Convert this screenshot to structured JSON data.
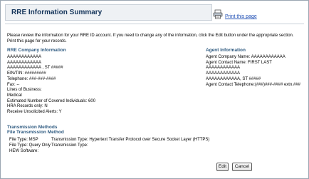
{
  "header": {
    "title": "RRE Information Summary"
  },
  "print": {
    "label": "Print this page"
  },
  "intro": {
    "line1": "Please review the information for your RRE ID account. If you need to change any of the information, click the Edit button under the appropriate section.",
    "line2": "Print this page for your records."
  },
  "rre_company": {
    "heading": "RRE Company Information",
    "lines": [
      "AAAAAAAAAAAA",
      "AAAAAAAAAAAA",
      "AAAAAAAAAAAA , ST #####",
      "EIN/TIN: #########",
      "Telephone: ###-###-####",
      "Fax: --",
      "Lines of Business:",
      "Medical",
      "Estimated Number of Covered Individuals: 600",
      "HRA Records only: N",
      "Receive Unsolicited Alerts: Y"
    ]
  },
  "agent": {
    "heading": "Agent Information",
    "lines": [
      "Agent Company Name: AAAAAAAAAAAA",
      "Agent Contact Name: FIRST LAST",
      "AAAAAAAAAAAA",
      "AAAAAAAAAAAA",
      "AAAAAAAAAAAA, ST #####",
      "Agent Contact Telephone:(###)###-#### extn.###"
    ]
  },
  "transmission": {
    "heading1": "Transmission Methods",
    "heading2": "File Transmission Method",
    "rows": [
      {
        "file_type": "File Type: MSP",
        "trans_type": "Transmission Type: Hypertext Transfer Protocol over Secure Socket Layer (HTTPS)"
      },
      {
        "file_type": "File Type: Query Only",
        "trans_type": "Transmission Type:"
      }
    ],
    "hew": "HEW Software:"
  },
  "buttons": {
    "edit": "Edit",
    "cancel": "Cancel"
  },
  "colors": {
    "heading": "#2e5a80",
    "title": "#16365b",
    "link": "#1f4fb5",
    "border": "#9aa6b2"
  }
}
